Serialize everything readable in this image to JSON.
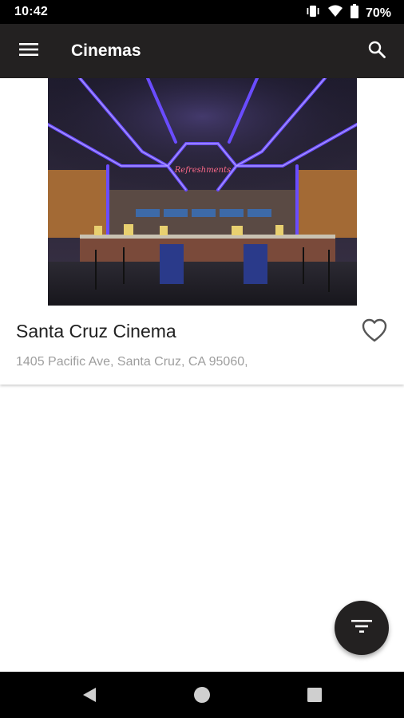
{
  "status_bar": {
    "time": "10:42",
    "battery": "70%",
    "icons": [
      "vibrate-icon",
      "wifi-icon",
      "battery-icon"
    ]
  },
  "app_bar": {
    "title": "Cinemas",
    "menu_icon": "menu-icon",
    "search_icon": "search-icon",
    "background": "#232121"
  },
  "cinemas": [
    {
      "name": "Santa Cruz Cinema",
      "address": "1405 Pacific Ave, Santa Cruz, CA 95060,",
      "photo_sign": "Refreshments",
      "favorite": false
    }
  ],
  "fab": {
    "icon": "filter-icon"
  },
  "nav_bar": {
    "icons": [
      "back-icon",
      "home-icon",
      "recents-icon"
    ]
  },
  "colors": {
    "accent": "#232121",
    "neon": "#6a4cff",
    "address_text": "#9e9e9e"
  }
}
